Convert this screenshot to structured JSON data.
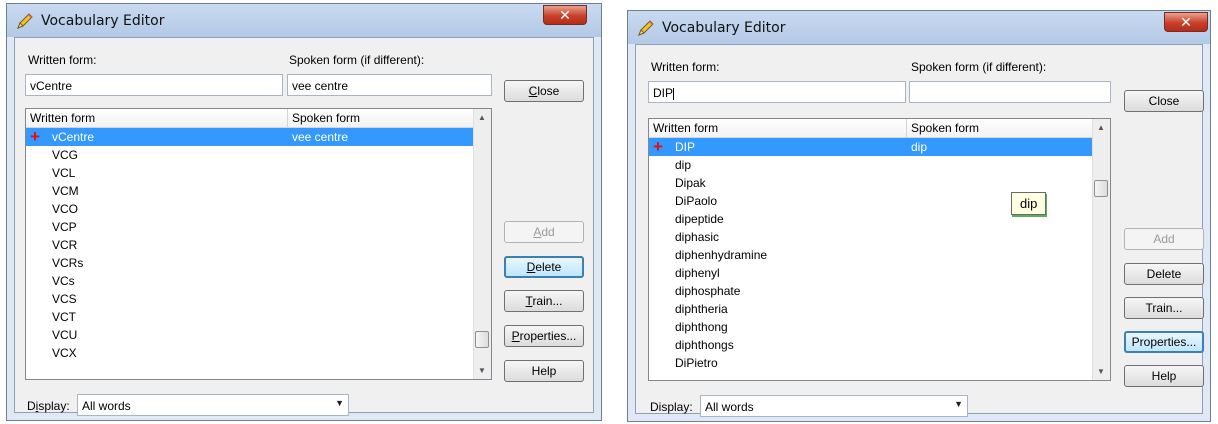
{
  "left": {
    "title": "Vocabulary Editor",
    "written_label": "Written form:",
    "spoken_label": "Spoken form (if different):",
    "written_value": "vCentre",
    "spoken_value": "vee centre",
    "col_written": "Written form",
    "col_spoken": "Spoken form",
    "rows": [
      {
        "w": "vCentre",
        "s": "vee centre"
      },
      {
        "w": "VCG",
        "s": ""
      },
      {
        "w": "VCL",
        "s": ""
      },
      {
        "w": "VCM",
        "s": ""
      },
      {
        "w": "VCO",
        "s": ""
      },
      {
        "w": "VCP",
        "s": ""
      },
      {
        "w": "VCR",
        "s": ""
      },
      {
        "w": "VCRs",
        "s": ""
      },
      {
        "w": "VCs",
        "s": ""
      },
      {
        "w": "VCS",
        "s": ""
      },
      {
        "w": "VCT",
        "s": ""
      },
      {
        "w": "VCU",
        "s": ""
      },
      {
        "w": "VCX",
        "s": ""
      }
    ],
    "buttons": {
      "close": "Close",
      "add": "Add",
      "delete": "Delete",
      "train": "Train...",
      "properties": "Properties...",
      "help": "Help"
    },
    "display_label": "Display:",
    "display_value": "All words"
  },
  "right": {
    "title": "Vocabulary Editor",
    "written_label": "Written form:",
    "spoken_label": "Spoken form (if different):",
    "written_value": "DIP",
    "spoken_value": "",
    "col_written": "Written form",
    "col_spoken": "Spoken form",
    "rows": [
      {
        "w": "DIP",
        "s": "dip"
      },
      {
        "w": "dip",
        "s": ""
      },
      {
        "w": "Dipak",
        "s": ""
      },
      {
        "w": "DiPaolo",
        "s": ""
      },
      {
        "w": "dipeptide",
        "s": ""
      },
      {
        "w": "diphasic",
        "s": ""
      },
      {
        "w": "diphenhydramine",
        "s": ""
      },
      {
        "w": "diphenyl",
        "s": ""
      },
      {
        "w": "diphosphate",
        "s": ""
      },
      {
        "w": "diphtheria",
        "s": ""
      },
      {
        "w": "diphthong",
        "s": ""
      },
      {
        "w": "diphthongs",
        "s": ""
      },
      {
        "w": "DiPietro",
        "s": ""
      }
    ],
    "tooltip": "dip",
    "buttons": {
      "close": "Close",
      "add": "Add",
      "delete": "Delete",
      "train": "Train...",
      "properties": "Properties...",
      "help": "Help"
    },
    "display_label": "Display:",
    "display_value": "All words"
  },
  "icons": {
    "title": "pencil-icon",
    "close": "close-x-icon",
    "selected_marker": "red-plus-icon"
  },
  "colors": {
    "selection": "#3399ff",
    "close_button": "#c7402b",
    "marker": "#e01010"
  }
}
